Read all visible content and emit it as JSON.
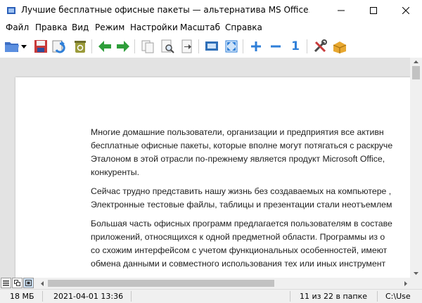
{
  "window": {
    "title": "Лучшие бесплатные офисные пакеты — альтернатива MS Office.rtf - Universal ..."
  },
  "menu": [
    {
      "label": "Файл"
    },
    {
      "label": "Правка"
    },
    {
      "label": "Вид"
    },
    {
      "label": "Режим"
    },
    {
      "label": "Настройки"
    },
    {
      "label": "Масштаб"
    },
    {
      "label": "Справка"
    }
  ],
  "toolbar": {
    "icons": [
      "open-folder-icon",
      "dropdown-arrow-icon",
      "save-icon",
      "reload-icon",
      "recycle-bin-icon",
      "back-arrow-icon",
      "forward-arrow-icon",
      "copy-icon",
      "print-preview-icon",
      "export-icon",
      "slideshow-icon",
      "fullscreen-icon",
      "zoom-in-icon",
      "zoom-out-icon",
      "original-size-icon",
      "options-icon",
      "package-icon"
    ],
    "original_size_label": "1"
  },
  "document": {
    "paragraphs": [
      [
        "Многие домашние пользователи, организации и предприятия все активн",
        "бесплатные офисные пакеты, которые вполне могут потягаться с раскруче",
        "Эталоном в этой отрасли по-прежнему является продукт Microsoft Office, ",
        "конкуренты."
      ],
      [
        "Сейчас трудно представить нашу жизнь без создаваемых на компьютере ,",
        "Электронные тестовые файлы, таблицы и презентации стали неотъемлем"
      ],
      [
        "Большая часть офисных программ предлагается пользователям в составе",
        "приложений, относящихся к одной предметной области. Программы из о",
        "со схожим интерфейсом с учетом функциональных особенностей, имеют",
        "обмена данными и совместного использования тех или иных инструмент"
      ]
    ]
  },
  "status": {
    "size": "18 МБ",
    "datetime": "2021-04-01 13:36",
    "position": "11 из 22 в папке",
    "path": "C:\\Use"
  },
  "colors": {
    "green_arrow": "#2e9e3a",
    "blue_tool": "#2f7fd8",
    "viewer_bg": "#e3e3e3"
  }
}
